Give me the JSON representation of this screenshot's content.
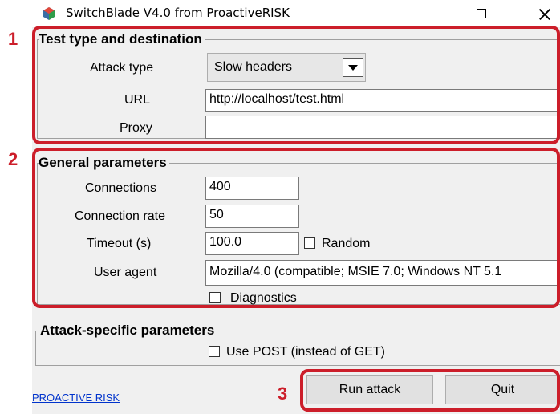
{
  "window": {
    "title": "SwitchBlade V4.0 from ProactiveRISK"
  },
  "groups": {
    "test": {
      "title": "Test type and destination"
    },
    "general": {
      "title": "General parameters"
    },
    "attack": {
      "title": "Attack-specific parameters"
    }
  },
  "test": {
    "attack_type_label": "Attack type",
    "attack_type_value": "Slow headers",
    "url_label": "URL",
    "url_value": "http://localhost/test.html",
    "proxy_label": "Proxy",
    "proxy_value": ""
  },
  "general": {
    "connections_label": "Connections",
    "connections_value": "400",
    "rate_label": "Connection rate",
    "rate_value": "50",
    "timeout_label": "Timeout (s)",
    "timeout_value": "100.0",
    "random_label": "Random",
    "useragent_label": "User agent",
    "useragent_value": "Mozilla/4.0 (compatible; MSIE 7.0; Windows NT 5.1",
    "diagnostics_label": "Diagnostics"
  },
  "attack": {
    "use_post_label": "Use POST (instead of GET)"
  },
  "footer": {
    "link_label": "PROACTIVE RISK",
    "run_label": "Run attack",
    "quit_label": "Quit"
  },
  "callouts": [
    "1",
    "2",
    "3"
  ],
  "colors": {
    "callout": "#cc1e2a",
    "link": "#0033cc"
  }
}
